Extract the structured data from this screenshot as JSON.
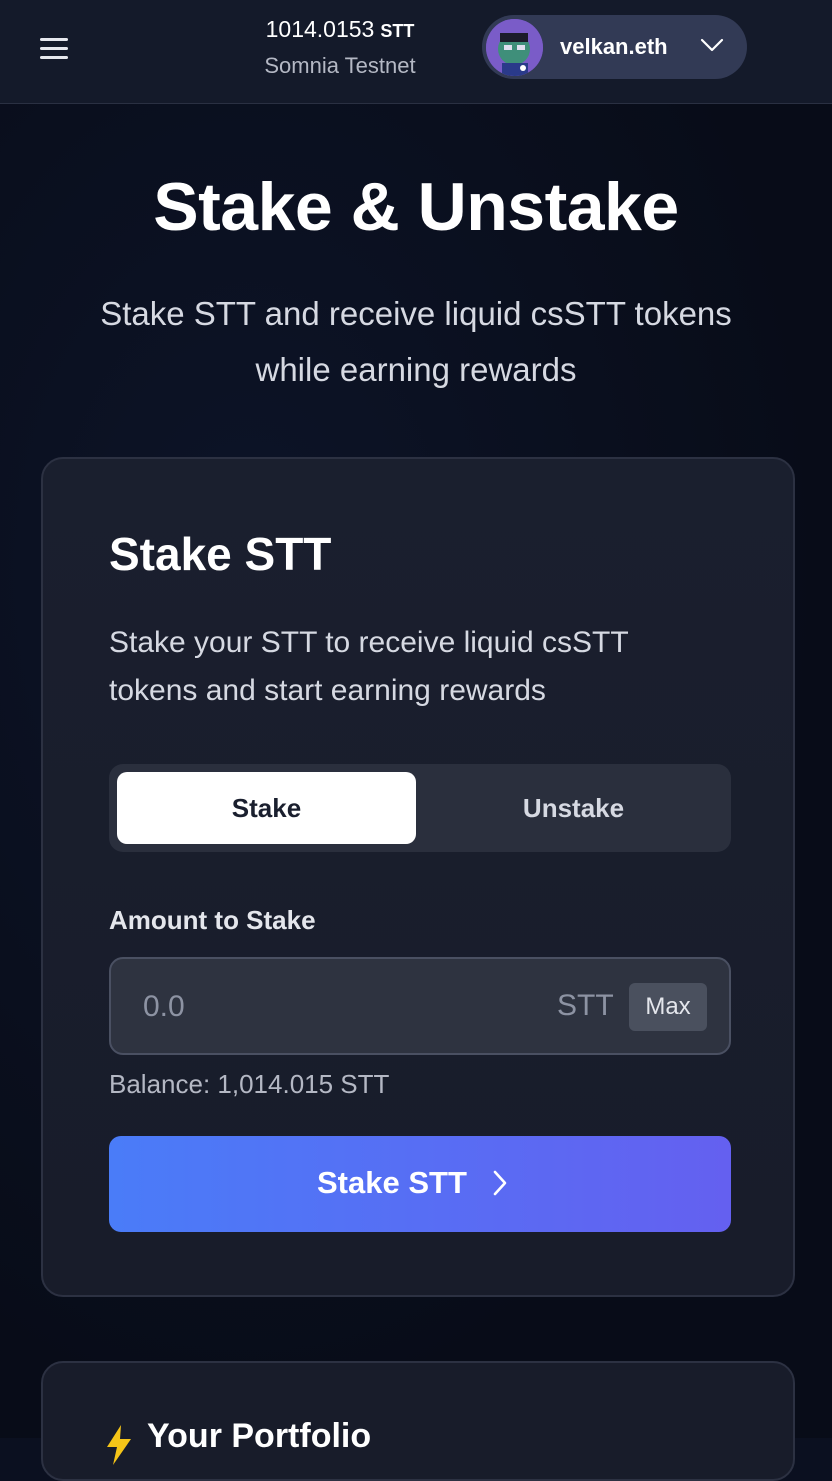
{
  "header": {
    "balance_amount": "1014.0153",
    "balance_unit": "STT",
    "network": "Somnia Testnet",
    "wallet_name": "velkan.eth"
  },
  "hero": {
    "title": "Stake & Unstake",
    "subtitle": "Stake STT and receive liquid csSTT tokens while earning rewards"
  },
  "stake_card": {
    "title": "Stake STT",
    "description": "Stake your STT to receive liquid csSTT tokens and start earning rewards",
    "tabs": [
      {
        "label": "Stake",
        "active": true
      },
      {
        "label": "Unstake",
        "active": false
      }
    ],
    "amount_label": "Amount to Stake",
    "amount_placeholder": "0.0",
    "amount_unit": "STT",
    "max_label": "Max",
    "balance_text": "Balance: 1,014.015 STT",
    "submit_label": "Stake STT"
  },
  "portfolio_card": {
    "title": "Your Portfolio"
  },
  "colors": {
    "accent_start": "#4a7cf8",
    "accent_end": "#6460f0",
    "background": "#0b1020",
    "card": "#1a1f2e",
    "portfolio_icon": "#f5c518"
  },
  "icons": {
    "menu": "hamburger-icon",
    "wallet_dropdown": "chevron-down-icon",
    "submit_arrow": "chevron-right-icon",
    "portfolio": "lightning-icon"
  }
}
